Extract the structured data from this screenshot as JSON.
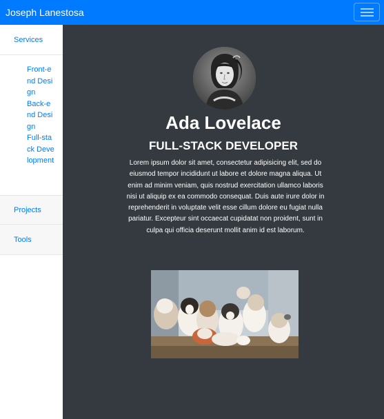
{
  "navbar": {
    "brand": "Joseph Lanestosa",
    "bg_color": "#007bff",
    "toggler_icon": "hamburger-icon"
  },
  "sidebar": {
    "items": [
      {
        "label": "Services"
      },
      {
        "label": "Projects"
      },
      {
        "label": "Tools"
      }
    ],
    "submenu": [
      {
        "label": "Front-end Design"
      },
      {
        "label": "Back-end Design"
      },
      {
        "label": "Full-stack Development"
      }
    ],
    "link_color": "#007bff"
  },
  "profile": {
    "name": "Ada Lovelace",
    "title": "FULL-STACK DEVELOPER",
    "bio": "Lorem ipsum dolor sit amet, consectetur adipisicing elit, sed do eiusmod tempor incididunt ut labore et dolore magna aliqua. Ut enim ad minim veniam, quis nostrud exercitation ullamco laboris nisi ut aliquip ex ea commodo consequat. Duis aute irure dolor in reprehenderit in voluptate velit esse cillum dolore eu fugiat nulla pariatur. Excepteur sint occaecat cupidatat non proident, sunt in culpa qui officia deserunt mollit anim id est laborum.",
    "avatar_subject": "portrait-avatar",
    "photo_subject": "puppies-photo"
  },
  "colors": {
    "main_bg": "#343a40",
    "text": "#ffffff"
  }
}
